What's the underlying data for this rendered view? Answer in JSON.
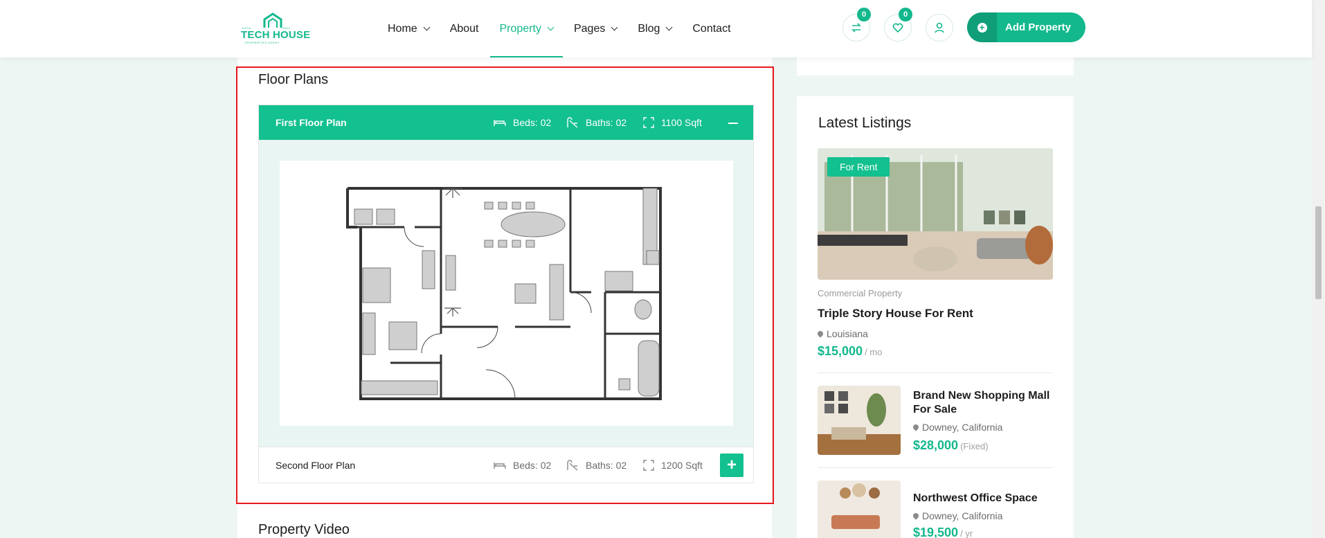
{
  "header": {
    "logo": {
      "name": "TECH HOUSE",
      "tag_left": "ESTA",
      "tag_right": "2003",
      "sub": "PROPERTIES AGENT"
    },
    "nav": [
      {
        "label": "Home",
        "dropdown": true
      },
      {
        "label": "About",
        "dropdown": false
      },
      {
        "label": "Property",
        "dropdown": true,
        "active": true
      },
      {
        "label": "Pages",
        "dropdown": true
      },
      {
        "label": "Blog",
        "dropdown": true
      },
      {
        "label": "Contact",
        "dropdown": false
      }
    ],
    "compare_count": "0",
    "wishlist_count": "0",
    "add_property": "Add Property"
  },
  "floor_plans": {
    "title": "Floor Plans",
    "plans": [
      {
        "name": "First Floor Plan",
        "beds": "Beds: 02",
        "baths": "Baths: 02",
        "area": "1100 Sqft",
        "expanded": true
      },
      {
        "name": "Second Floor Plan",
        "beds": "Beds: 02",
        "baths": "Baths: 02",
        "area": "1200 Sqft",
        "expanded": false
      }
    ]
  },
  "property_video": {
    "title": "Property Video"
  },
  "sidebar": {
    "latest_title": "Latest Listings",
    "featured": {
      "badge": "For Rent",
      "category": "Commercial Property",
      "title": "Triple Story House For Rent",
      "location": "Louisiana",
      "price": "$15,000",
      "unit": "/ mo"
    },
    "listings": [
      {
        "title": "Brand New Shopping Mall For Sale",
        "location": "Downey, California",
        "price": "$28,000",
        "unit": "(Fixed)"
      },
      {
        "title": "Northwest Office Space",
        "location": "Downey, California",
        "price": "$19,500",
        "unit": "/ yr"
      }
    ]
  },
  "colors": {
    "accent": "#13c08f",
    "highlight": "#e8161c"
  }
}
